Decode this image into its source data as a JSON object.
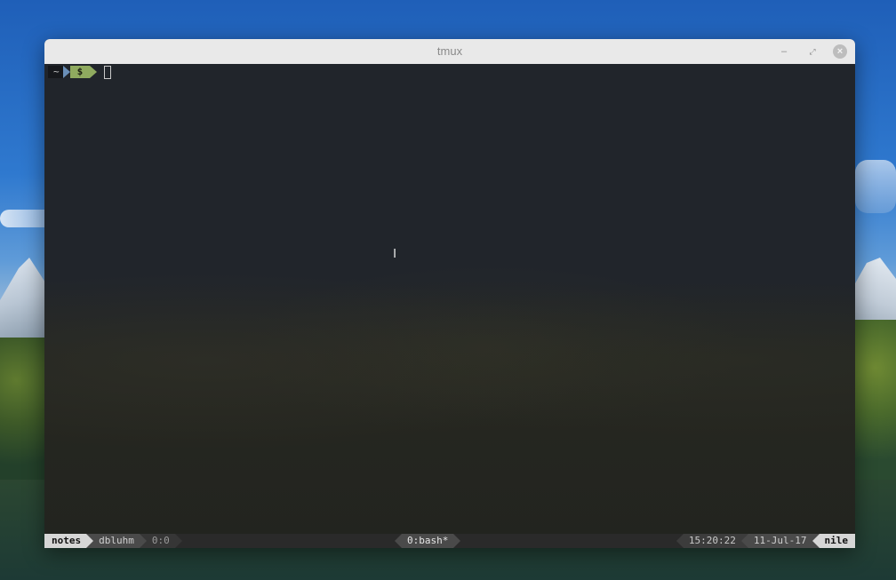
{
  "window": {
    "title": "tmux"
  },
  "prompt": {
    "home": "~",
    "symbol": "$"
  },
  "status_bar": {
    "session": "notes",
    "user": "dbluhm",
    "pane": "0:0",
    "window": "0:bash*",
    "time": "15:20:22",
    "date": "11-Jul-17",
    "host": "nile"
  }
}
